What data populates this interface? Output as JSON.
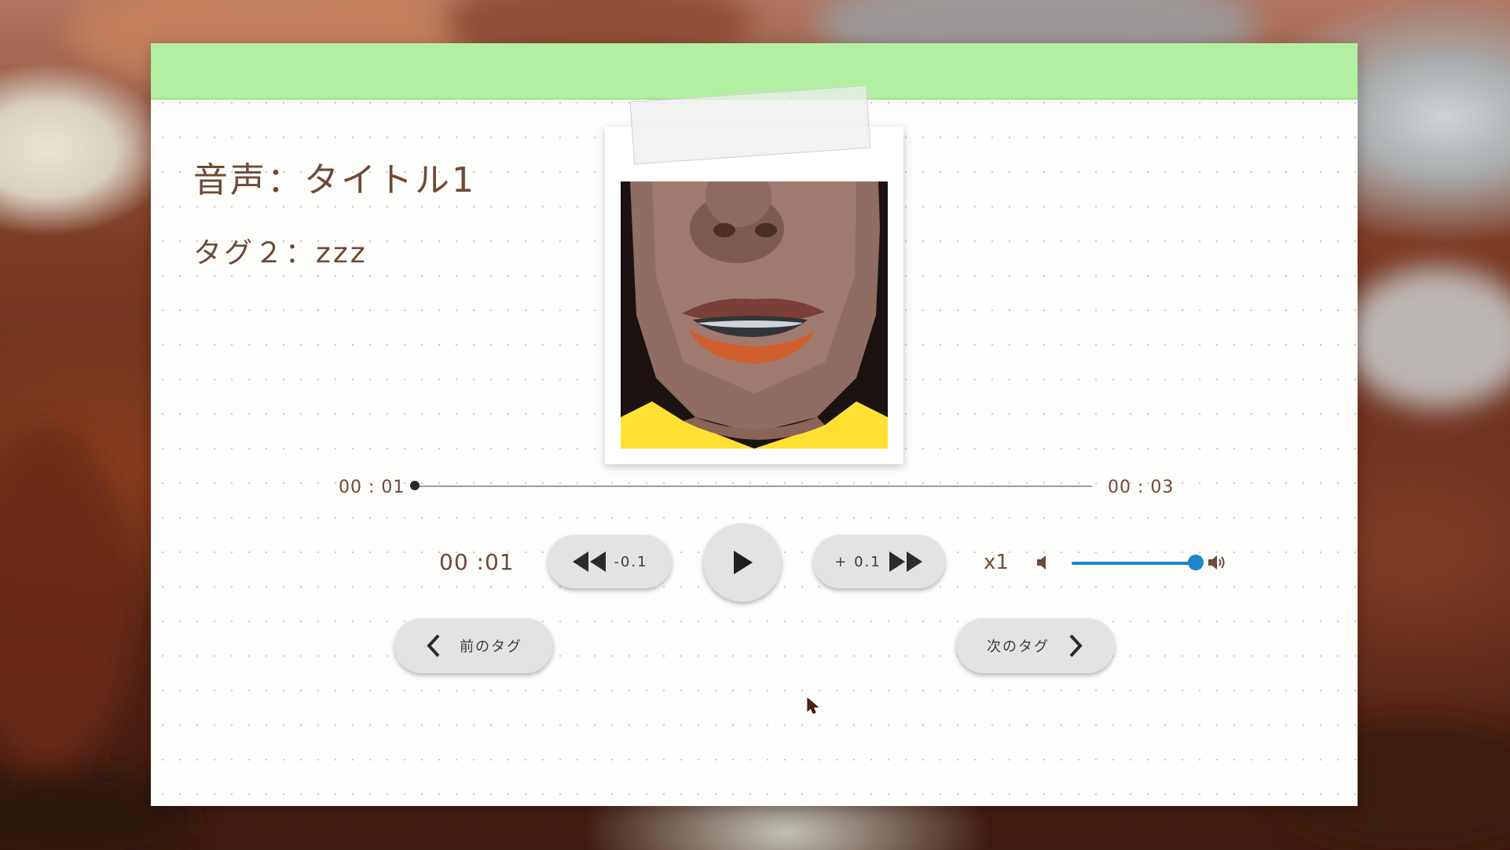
{
  "player": {
    "title": "音声：タイトル1",
    "tag_line": "タグ２：zzz",
    "seek": {
      "current": "00 : 01",
      "end": "00 : 03",
      "progress": 0.0
    },
    "counter": "00 :01",
    "step_back_label": "-0.1",
    "step_forward_label": "+ 0.1",
    "speed": "x1",
    "volume": 1.0,
    "prev_tag_label": "前のタグ",
    "next_tag_label": "次のタグ"
  },
  "colors": {
    "header": "#b2efa2",
    "text": "#6e4a36",
    "accent": "#1e86c8",
    "button": "#e3e3e3"
  },
  "icons": {
    "play": "play-icon",
    "rewind": "rewind-icon",
    "fast_forward": "fast-forward-icon",
    "chevron_left": "chevron-left-icon",
    "chevron_right": "chevron-right-icon",
    "volume_low": "volume-low-icon",
    "volume_high": "volume-high-icon"
  }
}
